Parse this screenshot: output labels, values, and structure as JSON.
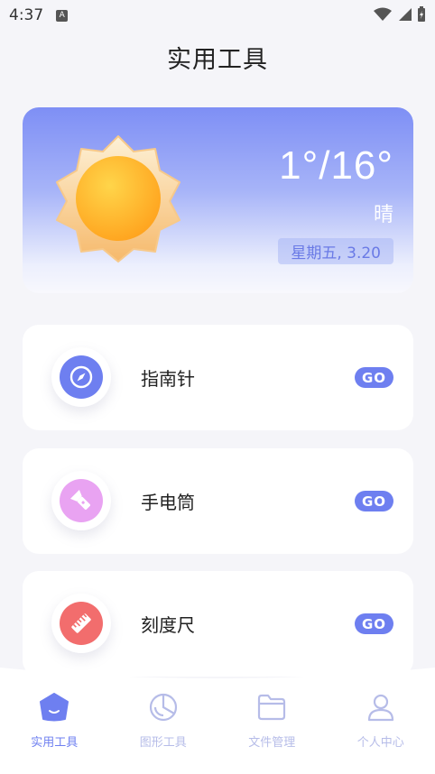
{
  "status_bar": {
    "time": "4:37",
    "notification_badge": "A"
  },
  "page_title": "实用工具",
  "weather": {
    "temperature": "1°/16°",
    "condition": "晴",
    "date": "星期五, 3.20",
    "icon": "sun-icon"
  },
  "tools": [
    {
      "label": "指南针",
      "action": "GO",
      "icon": "compass-icon",
      "color": "#6e7ff0"
    },
    {
      "label": "手电筒",
      "action": "GO",
      "icon": "flashlight-icon",
      "color": "#e9a3f2"
    },
    {
      "label": "刻度尺",
      "action": "GO",
      "icon": "ruler-icon",
      "color": "#f26d6d"
    }
  ],
  "bottom_nav": {
    "items": [
      {
        "label": "实用工具",
        "icon": "home-icon",
        "active": true
      },
      {
        "label": "图形工具",
        "icon": "pie-chart-icon",
        "active": false
      },
      {
        "label": "文件管理",
        "icon": "folder-icon",
        "active": false
      },
      {
        "label": "个人中心",
        "icon": "person-icon",
        "active": false
      }
    ]
  },
  "colors": {
    "accent": "#6e7ff0",
    "inactive": "#b6bce8",
    "background": "#f5f5f9"
  }
}
